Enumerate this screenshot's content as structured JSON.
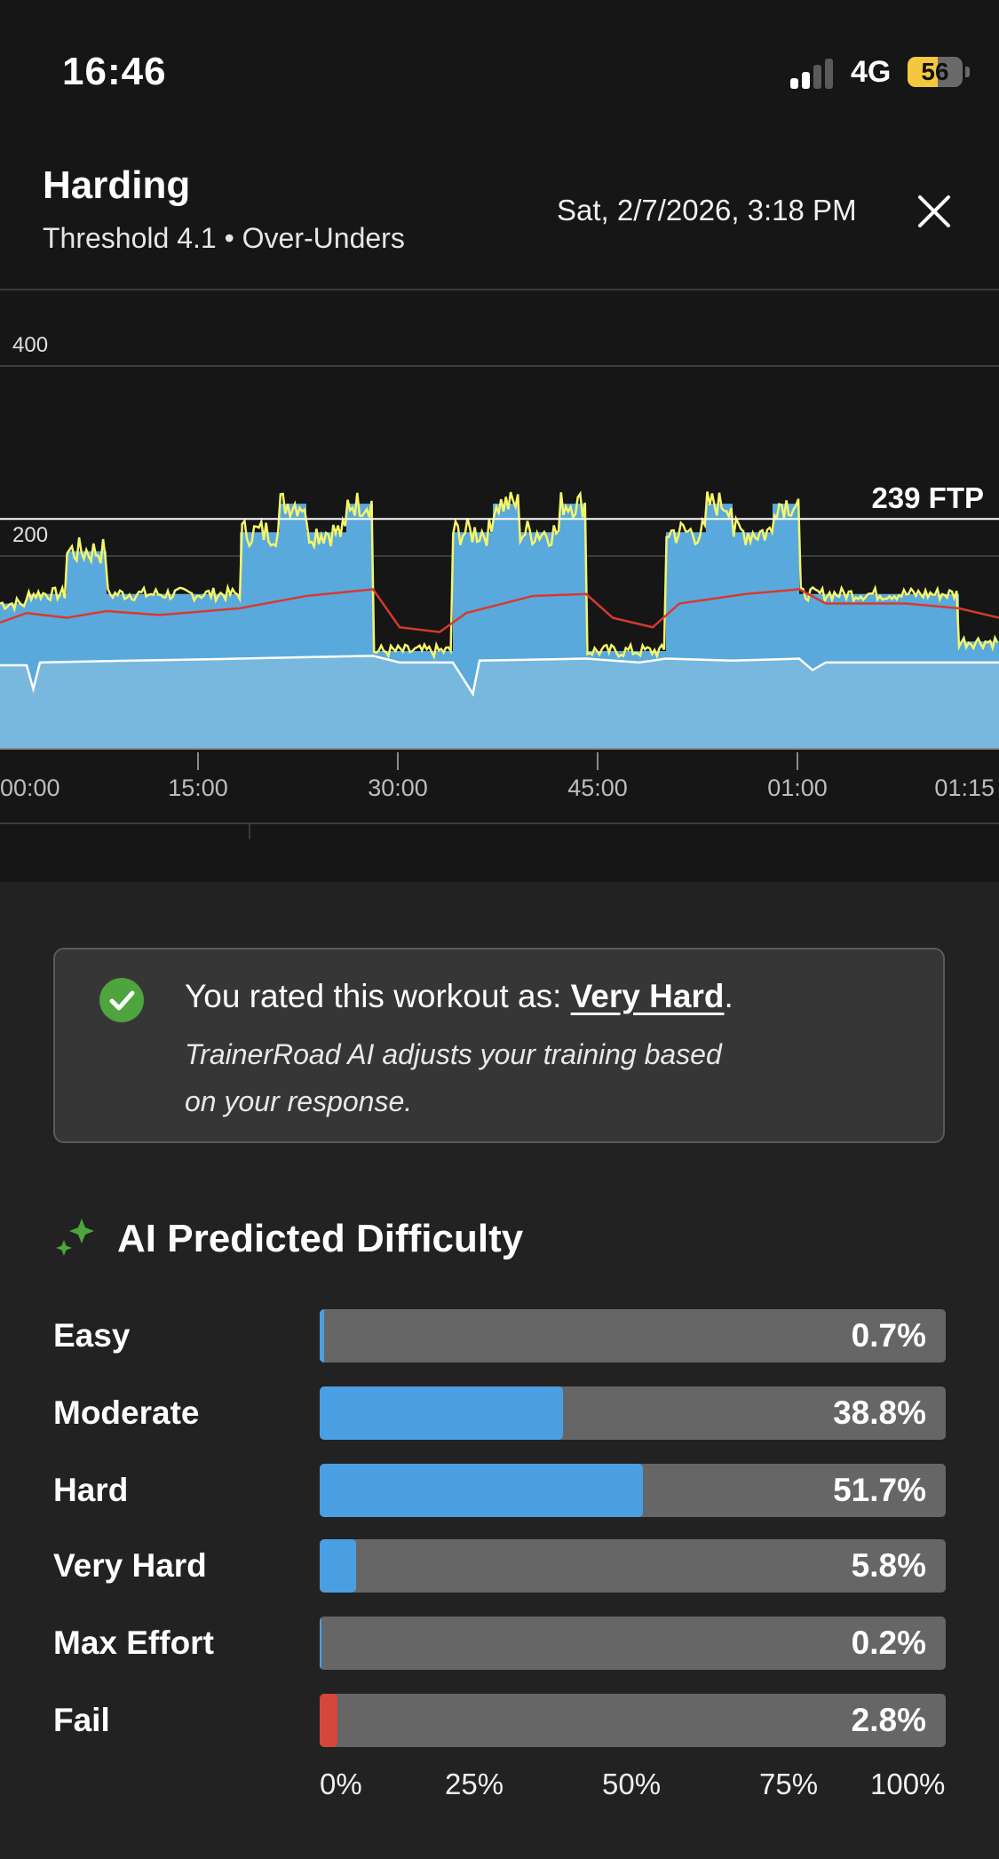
{
  "status_bar": {
    "time": "16:46",
    "network": "4G",
    "battery": "56"
  },
  "header": {
    "title": "Harding",
    "subtitle": "Threshold 4.1 • Over-Unders",
    "date": "Sat, 2/7/2026, 3:18 PM",
    "close_icon": "close-icon"
  },
  "chart_data": {
    "type": "area",
    "x_tick_labels": [
      "00:00",
      "15:00",
      "30:00",
      "45:00",
      "01:00",
      "01:15"
    ],
    "y_tick_labels": [
      "400",
      "200"
    ],
    "ftp_label": "239 FTP",
    "ftp_value": 239,
    "ylim": [
      0,
      450
    ],
    "xlim_minutes": [
      0,
      75
    ],
    "colors": {
      "target_area": "#5aa9dc",
      "power": "#f4f56a",
      "heart_rate": "#d63a2e",
      "cadence": "#ffffff",
      "background": "#161616"
    },
    "target_power_intervals": [
      {
        "start_min": 0,
        "end_min": 2,
        "watts": 150
      },
      {
        "start_min": 2,
        "end_min": 5,
        "watts": 160
      },
      {
        "start_min": 5,
        "end_min": 8,
        "watts": 205
      },
      {
        "start_min": 8,
        "end_min": 18,
        "watts": 160
      },
      {
        "start_min": 18,
        "end_min": 21,
        "watts": 225
      },
      {
        "start_min": 21,
        "end_min": 23,
        "watts": 255
      },
      {
        "start_min": 23,
        "end_min": 26,
        "watts": 225
      },
      {
        "start_min": 26,
        "end_min": 28,
        "watts": 255
      },
      {
        "start_min": 28,
        "end_min": 34,
        "watts": 100
      },
      {
        "start_min": 34,
        "end_min": 37,
        "watts": 225
      },
      {
        "start_min": 37,
        "end_min": 39,
        "watts": 255
      },
      {
        "start_min": 39,
        "end_min": 42,
        "watts": 225
      },
      {
        "start_min": 42,
        "end_min": 44,
        "watts": 255
      },
      {
        "start_min": 44,
        "end_min": 50,
        "watts": 100
      },
      {
        "start_min": 50,
        "end_min": 53,
        "watts": 225
      },
      {
        "start_min": 53,
        "end_min": 55,
        "watts": 255
      },
      {
        "start_min": 55,
        "end_min": 58,
        "watts": 225
      },
      {
        "start_min": 58,
        "end_min": 60,
        "watts": 255
      },
      {
        "start_min": 60,
        "end_min": 72,
        "watts": 160
      },
      {
        "start_min": 72,
        "end_min": 75,
        "watts": 110
      }
    ],
    "heart_rate_points": [
      [
        0,
        130
      ],
      [
        2,
        140
      ],
      [
        5,
        135
      ],
      [
        8,
        142
      ],
      [
        12,
        138
      ],
      [
        18,
        145
      ],
      [
        23,
        158
      ],
      [
        28,
        165
      ],
      [
        30,
        125
      ],
      [
        33,
        120
      ],
      [
        35,
        140
      ],
      [
        40,
        158
      ],
      [
        44,
        160
      ],
      [
        46,
        135
      ],
      [
        49,
        125
      ],
      [
        51,
        150
      ],
      [
        56,
        160
      ],
      [
        60,
        165
      ],
      [
        62,
        150
      ],
      [
        68,
        150
      ],
      [
        72,
        145
      ],
      [
        75,
        135
      ]
    ],
    "cadence_points": [
      [
        0,
        85
      ],
      [
        2,
        85
      ],
      [
        2.5,
        60
      ],
      [
        3,
        88
      ],
      [
        10,
        90
      ],
      [
        18,
        92
      ],
      [
        28,
        95
      ],
      [
        30,
        88
      ],
      [
        34,
        88
      ],
      [
        35.5,
        55
      ],
      [
        36,
        90
      ],
      [
        44,
        92
      ],
      [
        48,
        88
      ],
      [
        50,
        92
      ],
      [
        55,
        90
      ],
      [
        60,
        92
      ],
      [
        61,
        80
      ],
      [
        62,
        88
      ],
      [
        70,
        88
      ],
      [
        75,
        88
      ]
    ]
  },
  "rating_card": {
    "check_icon": "check-circle-icon",
    "prefix": "You rated this workout as: ",
    "value": "Very Hard",
    "suffix": ".",
    "note": "TrainerRoad AI adjusts your training based on your response."
  },
  "ai_predicted": {
    "icon": "sparkle-icon",
    "title": "AI Predicted Difficulty",
    "rows": [
      {
        "label": "Easy",
        "value_text": "0.7%",
        "percent": 0.7,
        "color": "#4a9fe3"
      },
      {
        "label": "Moderate",
        "value_text": "38.8%",
        "percent": 38.8,
        "color": "#4a9fe3"
      },
      {
        "label": "Hard",
        "value_text": "51.7%",
        "percent": 51.7,
        "color": "#4a9fe3"
      },
      {
        "label": "Very Hard",
        "value_text": "5.8%",
        "percent": 5.8,
        "color": "#4a9fe3"
      },
      {
        "label": "Max Effort",
        "value_text": "0.2%",
        "percent": 0.2,
        "color": "#4a9fe3"
      },
      {
        "label": "Fail",
        "value_text": "2.8%",
        "percent": 2.8,
        "color": "#d4473a"
      }
    ],
    "scale": [
      "0%",
      "25%",
      "50%",
      "75%",
      "100%"
    ]
  }
}
